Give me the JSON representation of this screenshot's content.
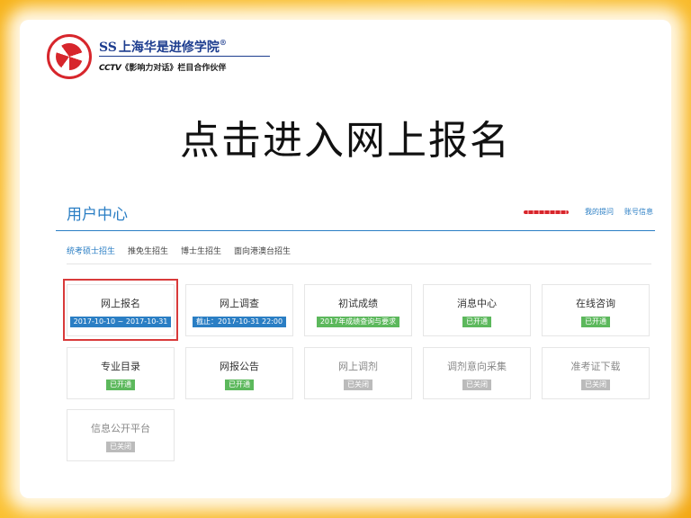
{
  "colors": {
    "accent_blue": "#2a7ec4",
    "open_green": "#5cb85c",
    "closed_gray": "#bbbbbb",
    "highlight_red": "#d93a3a",
    "frame_yellow": "#f6b51c"
  },
  "logo": {
    "title": "上海华是进修学院",
    "ss_mark": "SS",
    "registered": "®",
    "cctv": "CCTV",
    "subtitle": "《影响力对话》栏目合作伙伴"
  },
  "headline": "点击进入网上报名",
  "user_center": {
    "title": "用户中心",
    "links": {
      "my_questions": "我的提问",
      "account_info": "账号信息"
    }
  },
  "tabs": [
    {
      "label": "统考硕士招生",
      "active": true
    },
    {
      "label": "推免生招生",
      "active": false
    },
    {
      "label": "博士生招生",
      "active": false
    },
    {
      "label": "面向港澳台招生",
      "active": false
    }
  ],
  "cards": [
    {
      "name": "网上报名",
      "badge": "2017-10-10 ~ 2017-10-31",
      "status": "blue"
    },
    {
      "name": "网上调查",
      "badge": "截止：2017-10-31 22:00",
      "status": "blue"
    },
    {
      "name": "初试成绩",
      "badge": "2017年成绩查询与要求",
      "status": "green"
    },
    {
      "name": "消息中心",
      "badge": "已开通",
      "status": "green"
    },
    {
      "name": "在线咨询",
      "badge": "已开通",
      "status": "green"
    },
    {
      "name": "专业目录",
      "badge": "已开通",
      "status": "green"
    },
    {
      "name": "网报公告",
      "badge": "已开通",
      "status": "green"
    },
    {
      "name": "网上调剂",
      "badge": "已关闭",
      "status": "gray"
    },
    {
      "name": "调剂意向采集",
      "badge": "已关闭",
      "status": "gray"
    },
    {
      "name": "准考证下载",
      "badge": "已关闭",
      "status": "gray"
    },
    {
      "name": "信息公开平台",
      "badge": "已关闭",
      "status": "gray"
    }
  ]
}
